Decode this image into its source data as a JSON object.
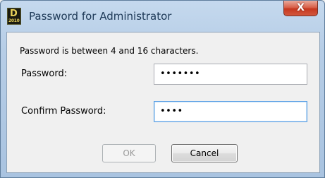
{
  "window": {
    "title": "Password for Administrator",
    "app_icon_letter": "D",
    "app_icon_year": "2010",
    "close_glyph": "X"
  },
  "form": {
    "info_text": "Password is between 4 and 16 characters.",
    "password_label": "Password:",
    "password_value": "•••••••",
    "confirm_label": "Confirm Password:",
    "confirm_value": "••••"
  },
  "buttons": {
    "ok_label": "OK",
    "ok_enabled": false,
    "cancel_label": "Cancel"
  },
  "colors": {
    "titlebar": "#b6cde6",
    "close_button": "#c6381f",
    "focus_border": "#569de5"
  }
}
